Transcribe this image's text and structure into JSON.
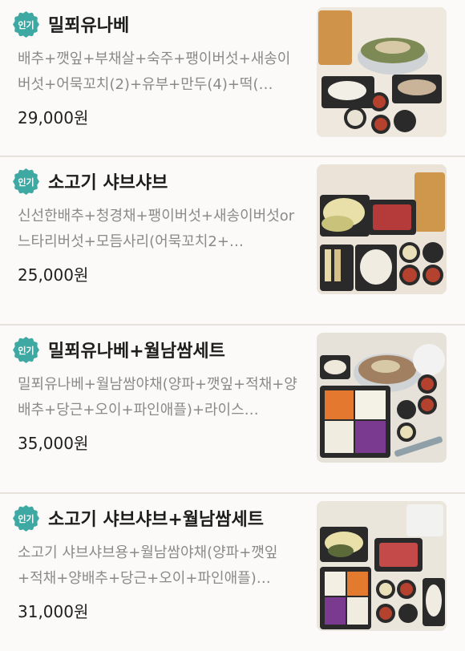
{
  "badge_label": "인기",
  "items": [
    {
      "name": "밀푀유나베",
      "description": "배추+깻잎+부채살+숙주+팽이버섯+새송이버섯+어묵꼬치(2)+유부+만두(4)+떡(…",
      "price": "29,000원"
    },
    {
      "name": "소고기 샤브샤브",
      "description": "신선한배추+청경채+팽이버섯+새송이버섯or느타리버섯+모듬사리(어묵꼬치2+…",
      "price": "25,000원"
    },
    {
      "name": "밀푀유나베+월남쌈세트",
      "description": "밀푀유나베+월남쌈야채(양파+깻잎+적채+양배추+당근+오이+파인애플)+라이스…",
      "price": "35,000원"
    },
    {
      "name": "소고기 샤브샤브+월남쌈세트",
      "description": "소고기 샤브샤브용+월남쌈야채(양파+깻잎+적채+양배추+당근+오이+파인애플)…",
      "price": "31,000원"
    }
  ]
}
